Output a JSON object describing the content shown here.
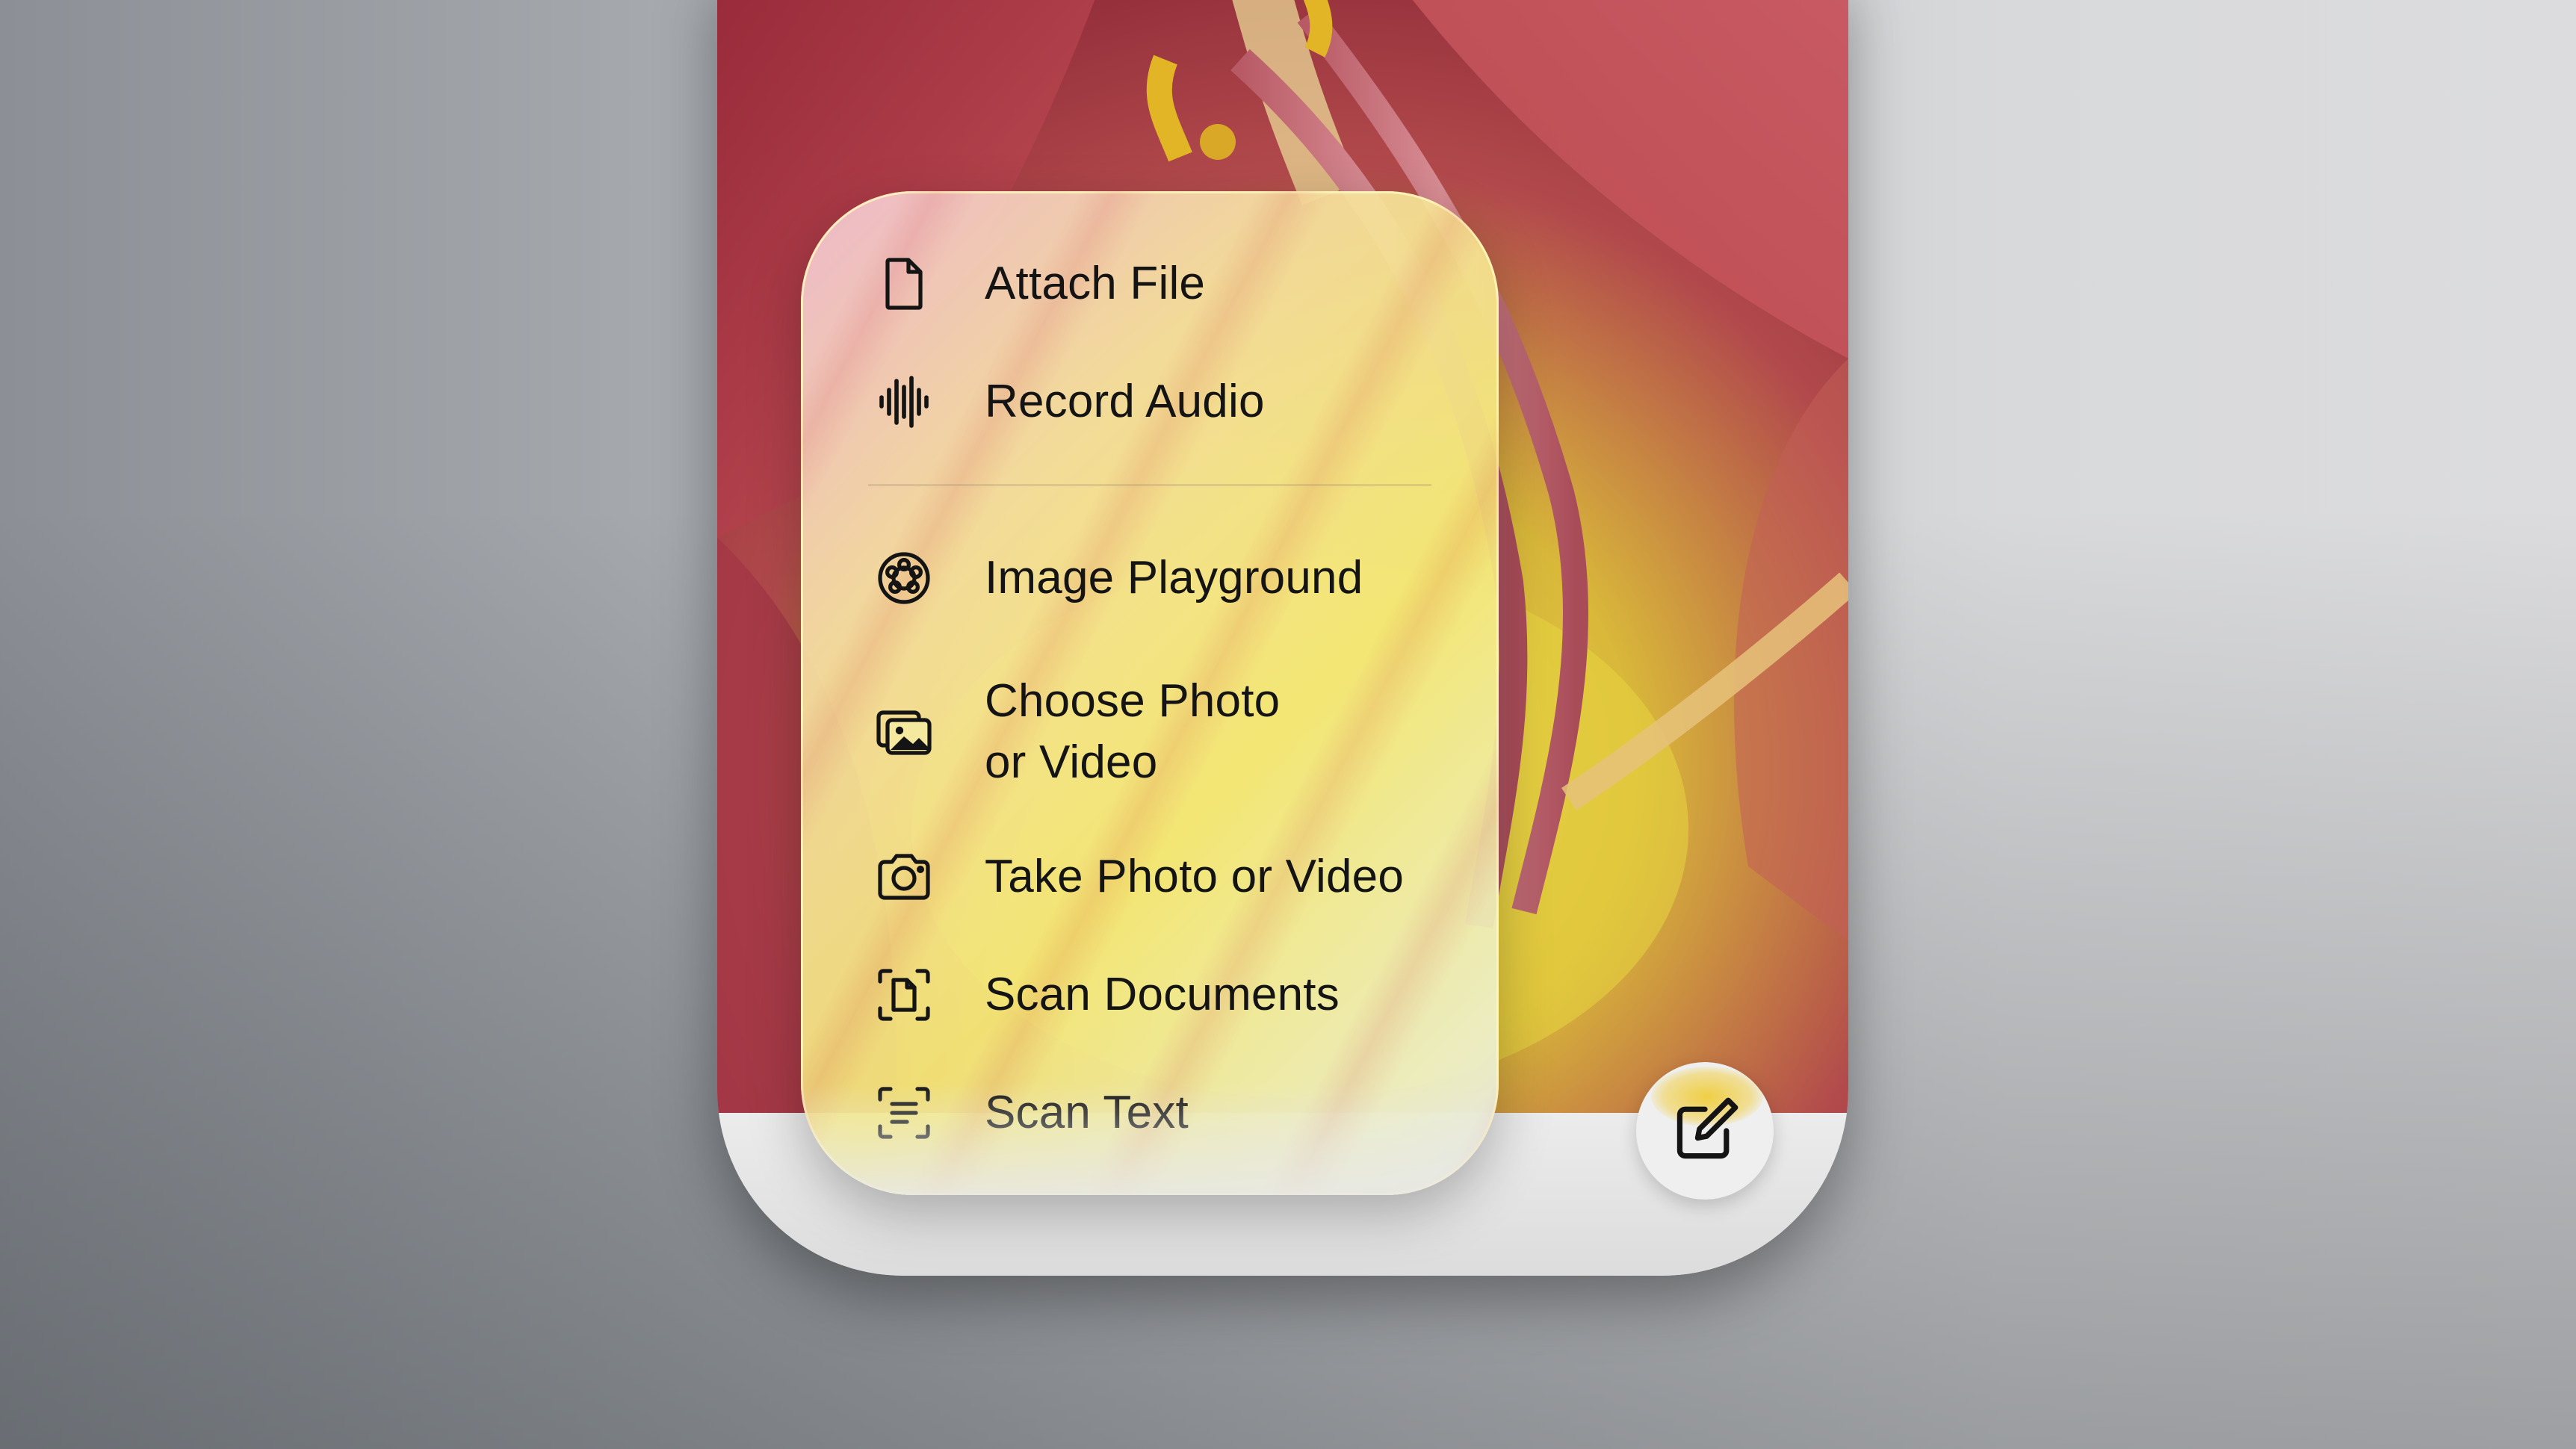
{
  "menu": {
    "items": [
      {
        "label": "Attach File",
        "icon": "document-icon"
      },
      {
        "label": "Record Audio",
        "icon": "waveform-icon"
      },
      {
        "label": "Image Playground",
        "icon": "image-playground-icon"
      },
      {
        "label": "Choose Photo\nor Video",
        "icon": "photo-library-icon"
      },
      {
        "label": "Take Photo or Video",
        "icon": "camera-icon"
      },
      {
        "label": "Scan Documents",
        "icon": "scan-document-icon"
      },
      {
        "label": "Scan Text",
        "icon": "scan-text-icon"
      }
    ]
  },
  "compose_button": {
    "icon": "compose-icon"
  },
  "colors": {
    "menu_text": "#141414",
    "menu_tint": "#f3e78a",
    "accent_glow": "#f0cd3c",
    "bottom_bar": "#e3e3e3"
  }
}
